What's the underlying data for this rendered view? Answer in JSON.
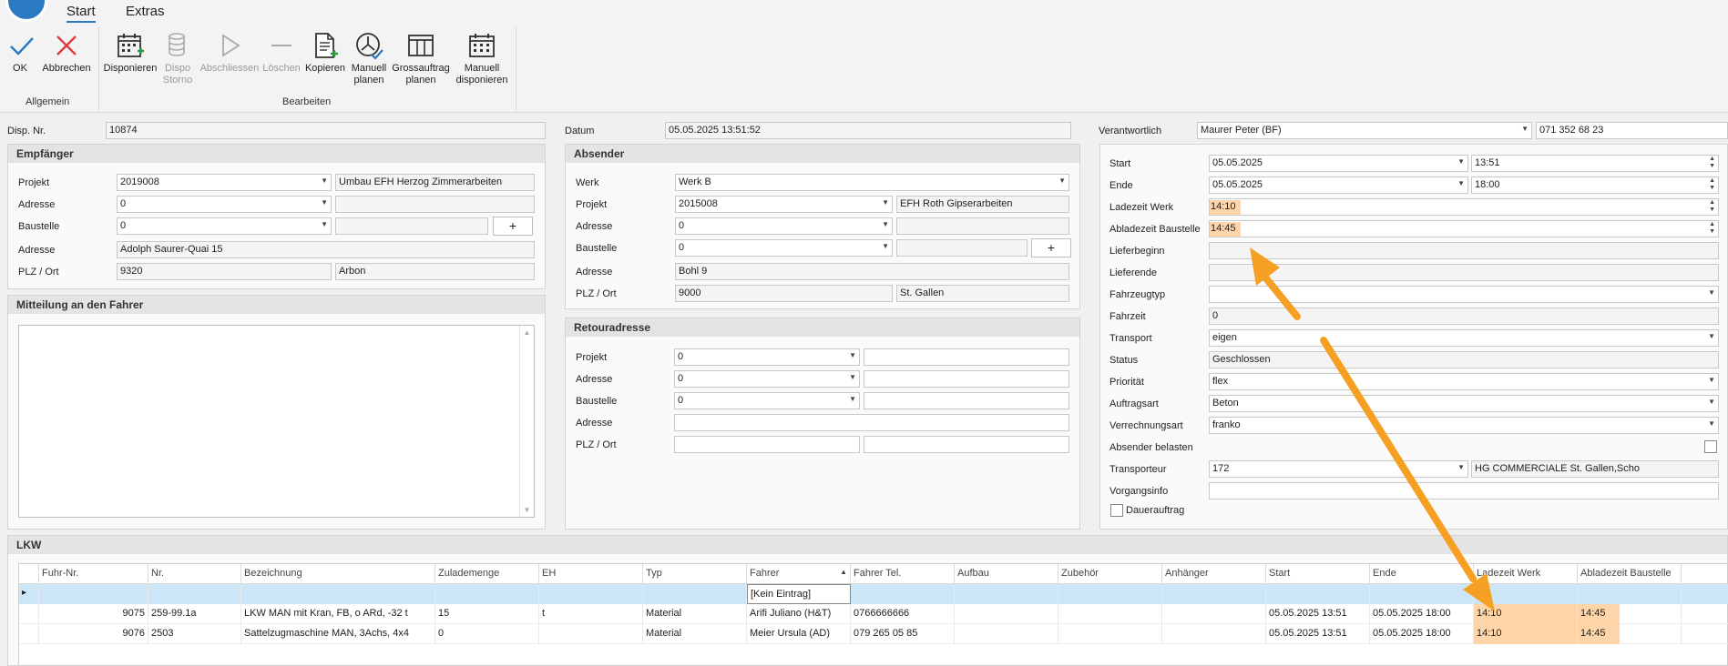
{
  "ribbon": {
    "tabs": [
      "Start",
      "Extras"
    ],
    "buttons": {
      "ok": "OK",
      "abbrechen": "Abbrechen",
      "disponieren": "Disponieren",
      "dispo_storno": "Dispo\nStorno",
      "abschliessen": "Abschliessen",
      "loeschen": "Löschen",
      "kopieren": "Kopieren",
      "manuell_planen": "Manuell\nplanen",
      "grossauftrag_planen": "Grossauftrag\nplanen",
      "manuell_disponieren": "Manuell\ndisponieren"
    },
    "groups": {
      "allgemein": "Allgemein",
      "bearbeiten": "Bearbeiten"
    }
  },
  "header": {
    "disp_nr_label": "Disp. Nr.",
    "disp_nr": "10874",
    "datum_label": "Datum",
    "datum": "05.05.2025 13:51:52",
    "verantwortlich_label": "Verantwortlich",
    "verantwortlich": "Maurer Peter (BF)",
    "telefon": "071 352 68 23"
  },
  "empfaenger": {
    "title": "Empfänger",
    "projekt_label": "Projekt",
    "projekt": "2019008",
    "projekt_text": "Umbau EFH Herzog Zimmerarbeiten",
    "adresse_label": "Adresse",
    "adresse": "0",
    "baustelle_label": "Baustelle",
    "baustelle": "0",
    "plus": "+",
    "adresse2_label": "Adresse",
    "adresse2": "Adolph Saurer-Quai 15",
    "plz_label": "PLZ / Ort",
    "plz": "9320",
    "ort": "Arbon"
  },
  "mitteilung": {
    "title": "Mitteilung an den Fahrer"
  },
  "absender": {
    "title": "Absender",
    "werk_label": "Werk",
    "werk": "Werk B",
    "projekt_label": "Projekt",
    "projekt": "2015008",
    "projekt_text": "EFH Roth Gipserarbeiten",
    "adresse_label": "Adresse",
    "adresse": "0",
    "baustelle_label": "Baustelle",
    "baustelle": "0",
    "plus": "+",
    "adresse2_label": "Adresse",
    "adresse2": "Bohl 9",
    "plz_label": "PLZ / Ort",
    "plz": "9000",
    "ort": "St. Gallen"
  },
  "retour": {
    "title": "Retouradresse",
    "projekt_label": "Projekt",
    "projekt": "0",
    "adresse_label": "Adresse",
    "adresse": "0",
    "baustelle_label": "Baustelle",
    "baustelle": "0",
    "adresse2_label": "Adresse",
    "plz_label": "PLZ / Ort"
  },
  "details": {
    "start_label": "Start",
    "start_date": "05.05.2025",
    "start_time": "13:51",
    "ende_label": "Ende",
    "ende_date": "05.05.2025",
    "ende_time": "18:00",
    "ladezeit_label": "Ladezeit Werk",
    "ladezeit": "14:10",
    "abladezeit_label": "Abladezeit Baustelle",
    "abladezeit": "14:45",
    "lieferbeginn_label": "Lieferbeginn",
    "lieferende_label": "Lieferende",
    "fahrzeugtyp_label": "Fahrzeugtyp",
    "fahrzeit_label": "Fahrzeit",
    "fahrzeit": "0",
    "transport_label": "Transport",
    "transport": "eigen",
    "status_label": "Status",
    "status": "Geschlossen",
    "prioritaet_label": "Priorität",
    "prioritaet": "flex",
    "auftragsart_label": "Auftragsart",
    "auftragsart": "Beton",
    "verrechnungsart_label": "Verrechnungsart",
    "verrechnungsart": "franko",
    "absender_belasten_label": "Absender belasten",
    "transporteur_label": "Transporteur",
    "transporteur": "172",
    "transporteur_text": "HG COMMERCIALE St. Gallen,Scho",
    "vorgangsinfo_label": "Vorgangsinfo",
    "dauerauftrag_label": "Dauerauftrag"
  },
  "lkw": {
    "title": "LKW",
    "columns": [
      "Fuhr-Nr.",
      "Nr.",
      "Bezeichnung",
      "Zulademenge",
      "EH",
      "Typ",
      "Fahrer",
      "Fahrer Tel.",
      "Aufbau",
      "Zubehör",
      "Anhänger",
      "Start",
      "Ende",
      "Ladezeit Werk",
      "Abladezeit Baustelle"
    ],
    "new_row_fahrer": "[Kein Eintrag]",
    "rows": [
      [
        "9075",
        "259-99.1a",
        "LKW MAN mit Kran, FB, o ARd, -32 t",
        "15",
        "t",
        "Material",
        "Arifi Juliano (H&T)",
        "0766666666",
        "",
        "",
        "",
        "05.05.2025 13:51",
        "05.05.2025 18:00",
        "14:10",
        "14:45"
      ],
      [
        "9076",
        "2503",
        "Sattelzugmaschine MAN, 3Achs, 4x4",
        "0",
        "",
        "Material",
        "Meier Ursula (AD)",
        "079 265 05 85",
        "",
        "",
        "",
        "05.05.2025 13:51",
        "05.05.2025 18:00",
        "14:10",
        "14:45"
      ]
    ]
  },
  "colors": {
    "highlight": "#fdd5a8",
    "arrow": "#f5a023",
    "accent": "#2b79c2"
  }
}
